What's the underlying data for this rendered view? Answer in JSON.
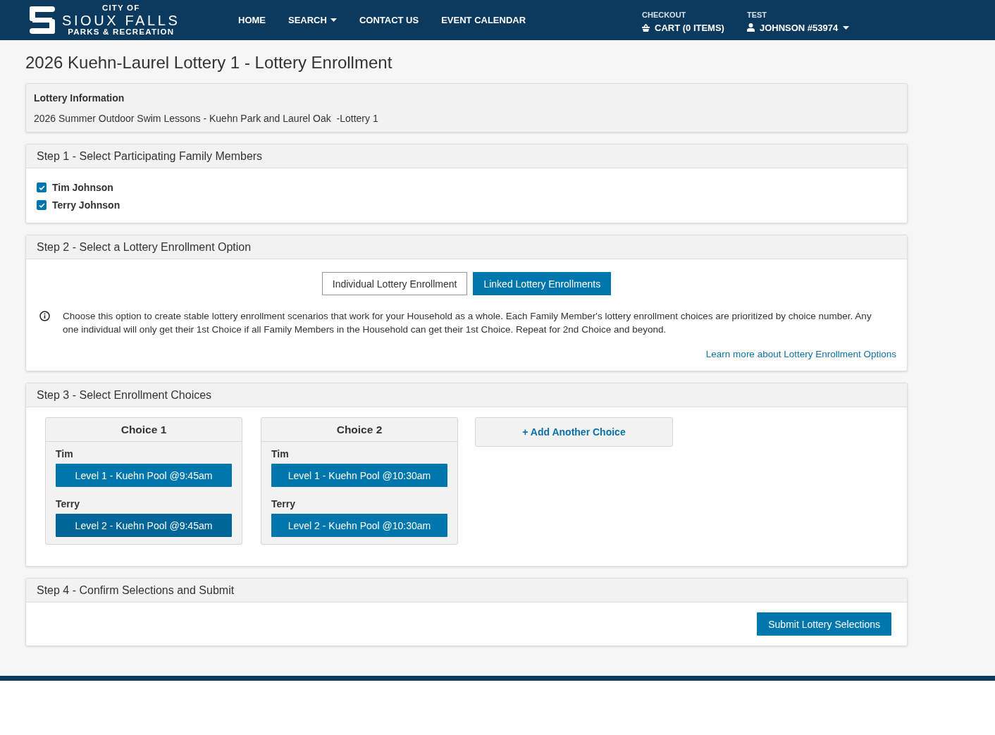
{
  "header": {
    "logo": {
      "line_1": "CITY OF",
      "line_2": "SIOUX FALLS",
      "line_3": "PARKS & RECREATION"
    },
    "nav": [
      {
        "label": "HOME",
        "kind": "link"
      },
      {
        "label": "SEARCH",
        "kind": "dropdown"
      },
      {
        "label": "CONTACT US",
        "kind": "link"
      },
      {
        "label": "EVENT CALENDAR",
        "kind": "link"
      }
    ],
    "checkout": {
      "caption": "CHECKOUT",
      "cart": "CART (0 ITEMS)"
    },
    "account": {
      "caption": "TEST",
      "user": "JOHNSON #53974"
    }
  },
  "page_title": "2026 Kuehn-Laurel Lottery 1 - Lottery Enrollment",
  "lottery_info": {
    "heading": "Lottery Information",
    "text": "2026 Summer Outdoor Swim Lessons - Kuehn Park and Laurel Oak  -Lottery 1"
  },
  "step_1": {
    "title": "Step 1 - Select Participating Family Members",
    "members": [
      {
        "name": "Tim Johnson",
        "checked": true
      },
      {
        "name": "Terry Johnson",
        "checked": true
      }
    ]
  },
  "step_2": {
    "title": "Step 2 - Select a Lottery Enrollment Option",
    "options": [
      {
        "label": "Individual Lottery Enrollment",
        "selected": false
      },
      {
        "label": "Linked Lottery Enrollments",
        "selected": true
      }
    ],
    "info": "Choose this option to create stable lottery enrollment scenarios that work for your Household as a whole. Each Family Member's lottery enrollment choices are prioritized by choice number. Any one individual will only get their 1st Choice if all Family Members in the Household can get their 1st Choice. Repeat for 2nd Choice and beyond.",
    "link": "Learn more about Lottery Enrollment Options"
  },
  "step_3": {
    "title": "Step 3 - Select Enrollment Choices",
    "choices": [
      {
        "title": "Choice 1",
        "slots": [
          {
            "member": "Tim",
            "option": "Level 1 - Kuehn Pool @9:45am",
            "highlighted": false
          },
          {
            "member": "Terry",
            "option": "Level 2 - Kuehn Pool @9:45am",
            "highlighted": true
          }
        ]
      },
      {
        "title": "Choice 2",
        "slots": [
          {
            "member": "Tim",
            "option": "Level 1 - Kuehn Pool @10:30am",
            "highlighted": false
          },
          {
            "member": "Terry",
            "option": "Level 2 - Kuehn Pool @10:30am",
            "highlighted": false
          }
        ]
      }
    ],
    "add_button": "+ Add Another Choice"
  },
  "step_4": {
    "title": "Step 4 - Confirm Selections and Submit",
    "submit": "Submit Lottery Selections"
  }
}
